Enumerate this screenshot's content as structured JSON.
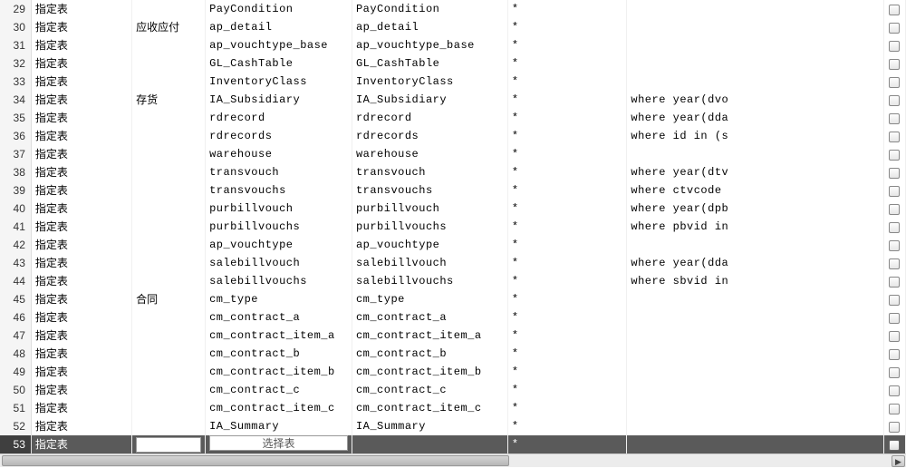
{
  "labels": {
    "row_type": "指定表",
    "select_table_btn": "选择表",
    "star": "*"
  },
  "rows": [
    {
      "n": 29,
      "group": "",
      "src": "PayCondition",
      "dst": "PayCondition",
      "cond": ""
    },
    {
      "n": 30,
      "group": "应收应付",
      "src": "ap_detail",
      "dst": "ap_detail",
      "cond": ""
    },
    {
      "n": 31,
      "group": "",
      "src": "ap_vouchtype_base",
      "dst": "ap_vouchtype_base",
      "cond": ""
    },
    {
      "n": 32,
      "group": "",
      "src": "GL_CashTable",
      "dst": "GL_CashTable",
      "cond": ""
    },
    {
      "n": 33,
      "group": "",
      "src": "InventoryClass",
      "dst": "InventoryClass",
      "cond": ""
    },
    {
      "n": 34,
      "group": "存货",
      "src": "IA_Subsidiary",
      "dst": "IA_Subsidiary",
      "cond": "where year(dvo"
    },
    {
      "n": 35,
      "group": "",
      "src": "rdrecord",
      "dst": "rdrecord",
      "cond": "where year(dda"
    },
    {
      "n": 36,
      "group": "",
      "src": "rdrecords",
      "dst": "rdrecords",
      "cond": "where id in (s"
    },
    {
      "n": 37,
      "group": "",
      "src": "warehouse",
      "dst": "warehouse",
      "cond": ""
    },
    {
      "n": 38,
      "group": "",
      "src": "transvouch",
      "dst": "transvouch",
      "cond": "where year(dtv"
    },
    {
      "n": 39,
      "group": "",
      "src": "transvouchs",
      "dst": "transvouchs",
      "cond": "where ctvcode"
    },
    {
      "n": 40,
      "group": "",
      "src": "purbillvouch",
      "dst": "purbillvouch",
      "cond": "where year(dpb"
    },
    {
      "n": 41,
      "group": "",
      "src": "purbillvouchs",
      "dst": "purbillvouchs",
      "cond": "where pbvid in"
    },
    {
      "n": 42,
      "group": "",
      "src": "ap_vouchtype",
      "dst": "ap_vouchtype",
      "cond": ""
    },
    {
      "n": 43,
      "group": "",
      "src": "salebillvouch",
      "dst": "salebillvouch",
      "cond": "where year(dda"
    },
    {
      "n": 44,
      "group": "",
      "src": "salebillvouchs",
      "dst": "salebillvouchs",
      "cond": "where sbvid in"
    },
    {
      "n": 45,
      "group": "合同",
      "src": "cm_type",
      "dst": "cm_type",
      "cond": ""
    },
    {
      "n": 46,
      "group": "",
      "src": "cm_contract_a",
      "dst": "cm_contract_a",
      "cond": ""
    },
    {
      "n": 47,
      "group": "",
      "src": "cm_contract_item_a",
      "dst": "cm_contract_item_a",
      "cond": ""
    },
    {
      "n": 48,
      "group": "",
      "src": "cm_contract_b",
      "dst": "cm_contract_b",
      "cond": ""
    },
    {
      "n": 49,
      "group": "",
      "src": "cm_contract_item_b",
      "dst": "cm_contract_item_b",
      "cond": ""
    },
    {
      "n": 50,
      "group": "",
      "src": "cm_contract_c",
      "dst": "cm_contract_c",
      "cond": ""
    },
    {
      "n": 51,
      "group": "",
      "src": "cm_contract_item_c",
      "dst": "cm_contract_item_c",
      "cond": ""
    },
    {
      "n": 52,
      "group": "",
      "src": "IA_Summary",
      "dst": "IA_Summary",
      "cond": ""
    }
  ],
  "selected_row": {
    "n": 53
  }
}
